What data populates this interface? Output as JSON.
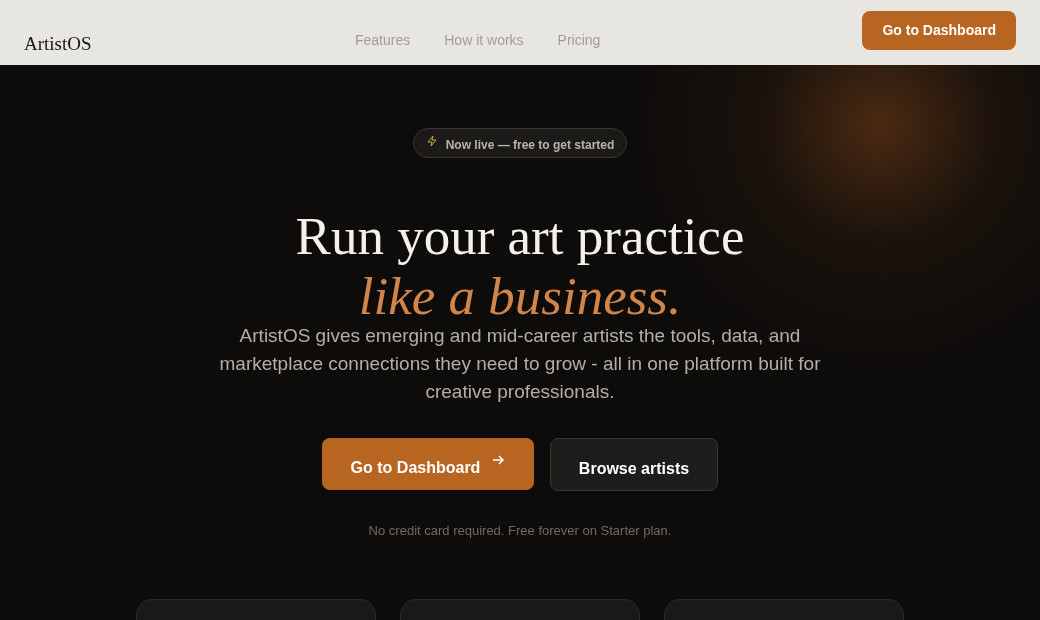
{
  "header": {
    "logo": "ArtistOS",
    "nav": [
      {
        "label": "Features"
      },
      {
        "label": "How it works"
      },
      {
        "label": "Pricing"
      }
    ],
    "cta": "Go to Dashboard"
  },
  "hero": {
    "badge": "Now live — free to get started",
    "headline": "Run your art practice",
    "headline_accent": "like a business.",
    "description": "ArtistOS gives emerging and mid-career artists the tools, data, and marketplace connections they need to grow - all in one platform built for creative professionals.",
    "buttons": [
      {
        "label": "Go to Dashboard",
        "kind": "primary"
      },
      {
        "label": "Browse artists",
        "kind": "secondary"
      }
    ],
    "note": "No credit card required. Free forever on Starter plan."
  }
}
